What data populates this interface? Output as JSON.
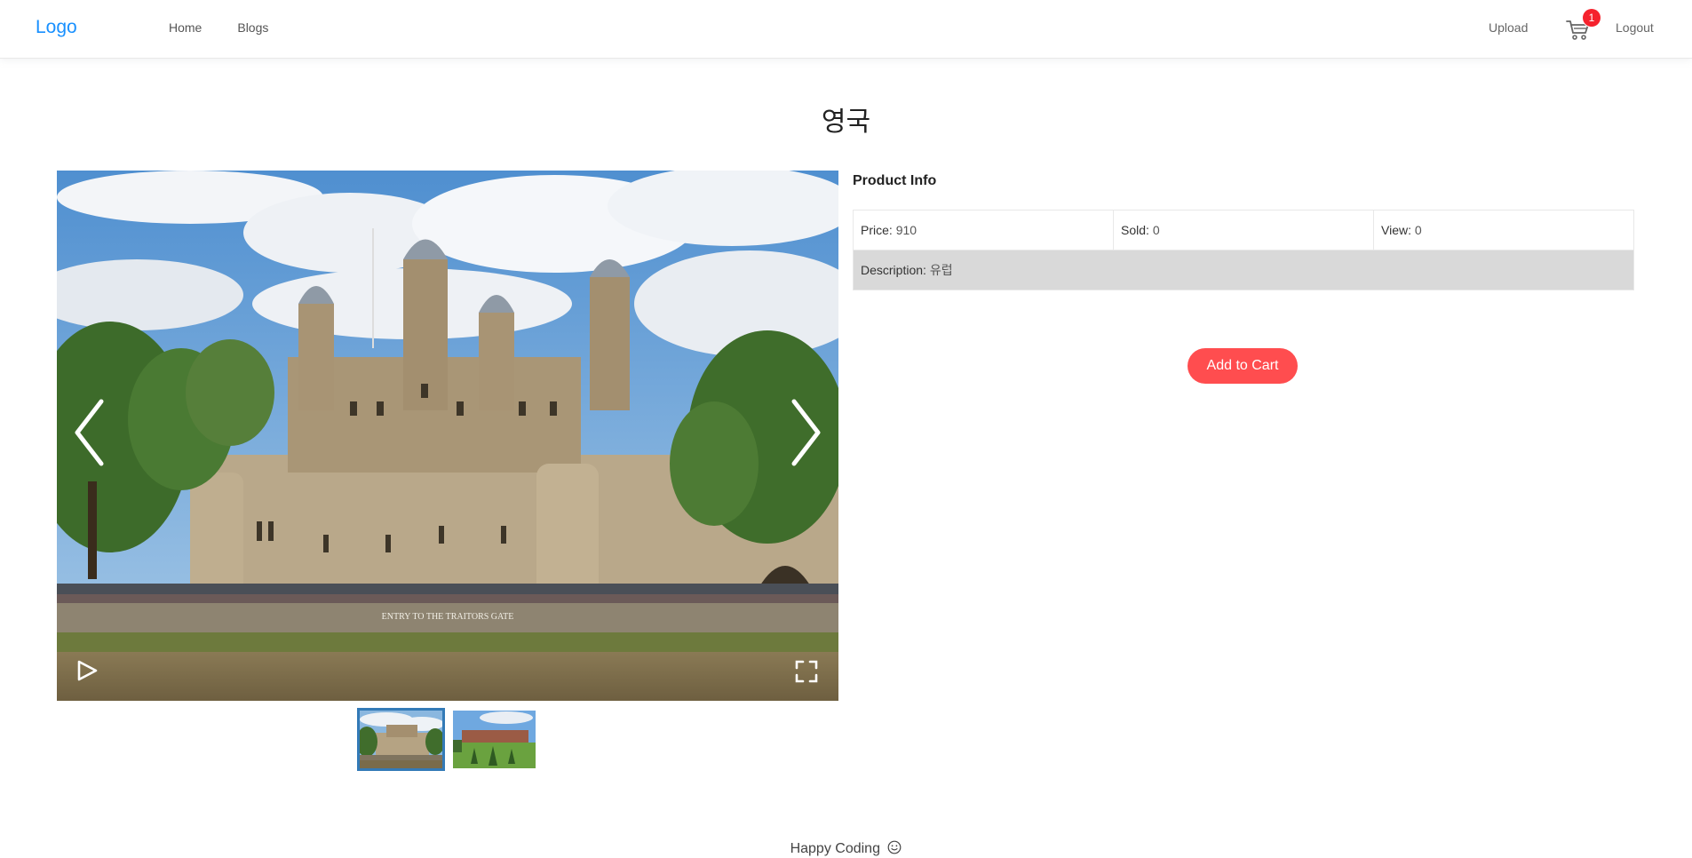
{
  "navbar": {
    "logo": "Logo",
    "links": [
      "Home",
      "Blogs"
    ],
    "upload": "Upload",
    "cart_count": "1",
    "logout": "Logout"
  },
  "product": {
    "title": "영국",
    "info_heading": "Product Info",
    "price_label": "Price",
    "price": "910",
    "sold_label": "Sold",
    "sold": "0",
    "view_label": "View",
    "view": "0",
    "description_label": "Description",
    "description": "유럽",
    "add_to_cart": "Add to Cart"
  },
  "gallery": {
    "main_image": "tower-of-london-photo",
    "caption_sign": "ENTRY TO THE TRAITORS GATE",
    "thumbnails": [
      "tower-of-london-thumb",
      "palace-garden-thumb"
    ],
    "active_index": 0
  },
  "footer": {
    "text": "Happy Coding",
    "icon": "smile-icon"
  },
  "colors": {
    "accent": "#1890ff",
    "badge": "#f5222d",
    "button": "#ff4d4f",
    "thumb_active": "#337ab7"
  }
}
